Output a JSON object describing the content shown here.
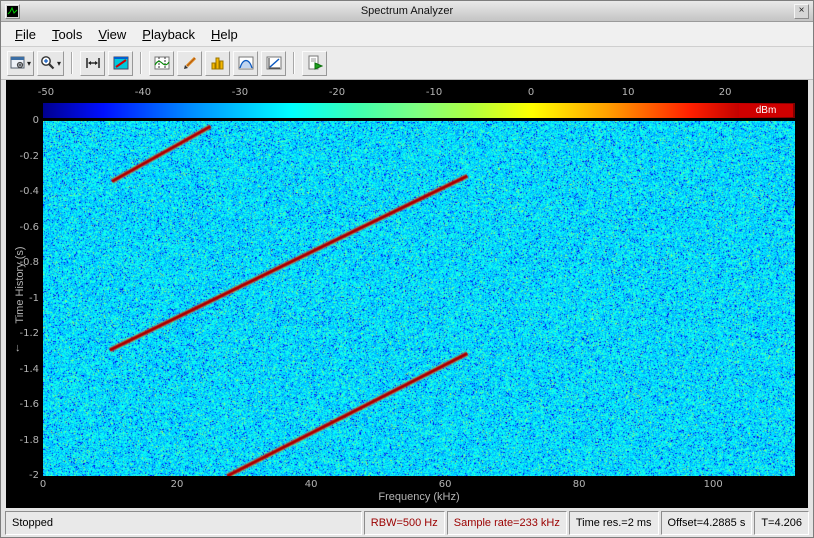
{
  "window": {
    "title": "Spectrum Analyzer"
  },
  "icons": {
    "close": "×",
    "dropdown": "▾"
  },
  "menu": {
    "items": [
      "File",
      "Tools",
      "View",
      "Playback",
      "Help"
    ]
  },
  "toolbar": {
    "buttons": [
      {
        "name": "configuration",
        "icon": "scope-config-icon",
        "dropdown": true
      },
      {
        "name": "zoom",
        "icon": "magnifier-icon",
        "dropdown": true
      },
      {
        "name": "span-x-axis",
        "icon": "horizontal-span-icon",
        "dropdown": false
      },
      {
        "name": "spectrogram-view",
        "icon": "spectrogram-icon",
        "dropdown": false
      },
      {
        "name": "cursor-measurements",
        "icon": "cursors-icon",
        "dropdown": false
      },
      {
        "name": "distortion-measurements",
        "icon": "pencil-icon",
        "dropdown": false
      },
      {
        "name": "peak-finder",
        "icon": "peaks-bars-icon",
        "dropdown": false
      },
      {
        "name": "channel-measurements",
        "icon": "bell-curve-icon",
        "dropdown": false
      },
      {
        "name": "ccdf-measurements",
        "icon": "ccdf-plot-icon",
        "dropdown": false
      },
      {
        "name": "playback-export",
        "icon": "page-play-icon",
        "dropdown": false
      }
    ]
  },
  "colorbar": {
    "tick_labels": [
      "-50",
      "-40",
      "-30",
      "-20",
      "-10",
      "0",
      "10",
      "20"
    ],
    "tick_values": [
      -50,
      -40,
      -30,
      -20,
      -10,
      0,
      10,
      20
    ],
    "range": [
      -50.3,
      27.2
    ],
    "unit_label": "dBm"
  },
  "chart_data": {
    "type": "heatmap",
    "subtype": "spectrogram",
    "xlabel": "Frequency (kHz)",
    "ylabel": "Time History (s)",
    "ylabel_arrow": "↓",
    "xlim": [
      0,
      112.2
    ],
    "ylim": [
      -2,
      0
    ],
    "x_ticks": [
      0,
      20,
      40,
      60,
      80,
      100
    ],
    "x_tick_labels": [
      "0",
      "20",
      "40",
      "60",
      "80",
      "100"
    ],
    "y_ticks": [
      0,
      -0.2,
      -0.4,
      -0.6,
      -0.8,
      -1,
      -1.2,
      -1.4,
      -1.6,
      -1.8,
      -2
    ],
    "y_tick_labels": [
      "0",
      "-0.2",
      "-0.4",
      "-0.6",
      "-0.8",
      "-1",
      "-1.2",
      "-1.4",
      "-1.6",
      "-1.8",
      "-2"
    ],
    "colormap": "jet",
    "color_scale_dbm": [
      -50.3,
      27.2
    ],
    "noise_floor_dbm": [
      -30,
      -17
    ],
    "signal": {
      "description": "repeating linear up-chirp (sawtooth frequency sweep), newest time at top",
      "level_dbm": 20,
      "chirp_rate_khz_per_s": 52,
      "segments": [
        {
          "f_start_khz": 10.3,
          "t_start_s": -0.34,
          "f_end_khz": 25.0,
          "t_end_s": -0.03
        },
        {
          "f_start_khz": 10.0,
          "t_start_s": -1.29,
          "f_end_khz": 63.3,
          "t_end_s": -0.31
        },
        {
          "f_start_khz": 27.5,
          "t_start_s": -2.0,
          "f_end_khz": 63.3,
          "t_end_s": -1.31
        }
      ]
    }
  },
  "status": {
    "state": "Stopped",
    "fields": [
      {
        "text": "RBW=500 Hz",
        "emphasis": true
      },
      {
        "text": "Sample rate=233 kHz",
        "emphasis": true
      },
      {
        "text": "Time res.=2 ms",
        "emphasis": false
      },
      {
        "text": "Offset=4.2885 s",
        "emphasis": false
      },
      {
        "text": "T=4.206",
        "emphasis": false
      }
    ]
  },
  "colors": {
    "status_emphasis": "#9b0000",
    "dbm_label_bg": "#cf0000",
    "plot_background": "#000000",
    "tick_label": "#b4b4b4",
    "noise_dominant": "#00c8dc",
    "chirp_line": "#d40000"
  }
}
